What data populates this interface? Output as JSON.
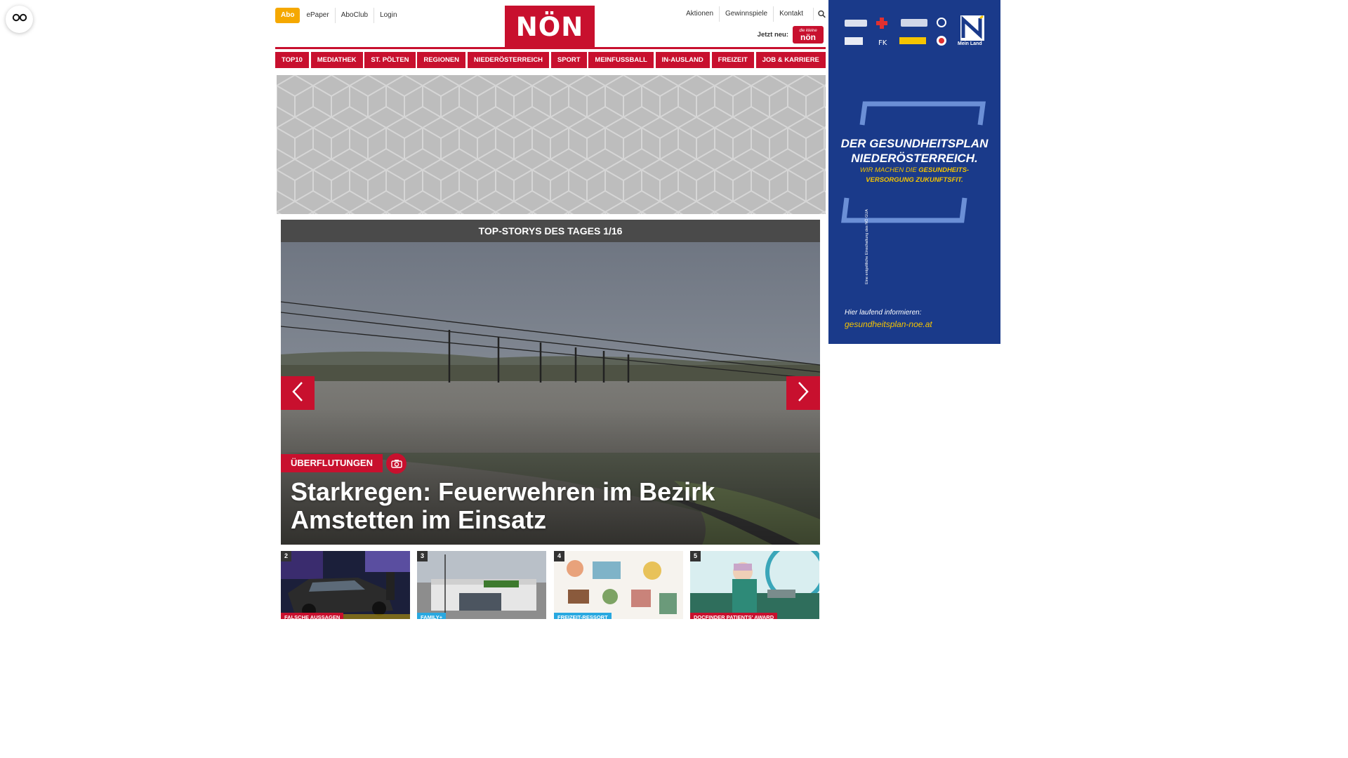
{
  "topnav": {
    "abo": "Abo",
    "links": [
      "ePaper",
      "AboClub",
      "Login"
    ]
  },
  "logo": "NÖN",
  "rightnav": {
    "links": [
      "Aktionen",
      "Gewinnspiele",
      "Kontakt"
    ],
    "jetzt_label": "Jetzt neu:",
    "badge_small": "die kleine",
    "badge_big": "nön"
  },
  "categories": [
    "TOP10",
    "MEDIATHEK",
    "ST. PÖLTEN",
    "REGIONEN",
    "NIEDERÖSTERREICH",
    "SPORT",
    "MEINFUSSBALL",
    "IN-AUSLAND",
    "FREIZEIT",
    "JOB & KARRIERE"
  ],
  "topstories": {
    "header": "TOP-STORYS DES TAGES 1/16",
    "tag": "ÜBERFLUTUNGEN",
    "title": "Starkregen: Feuerwehren im Bezirk Amstetten im Einsatz"
  },
  "thumbs": [
    {
      "num": "2",
      "tag": "FALSCHE AUSSAGEN",
      "tag_color": "#c8102e"
    },
    {
      "num": "3",
      "tag": "FAMILY+",
      "tag_color": "#29a8e0"
    },
    {
      "num": "4",
      "tag": "FREIZEIT-RESSORT",
      "tag_color": "#29a8e0"
    },
    {
      "num": "5",
      "tag": "DOCFINDER PATIENTS' AWARD",
      "tag_color": "#c8102e"
    }
  ],
  "sidead": {
    "title_line1": "DER GESUNDHEITSPLAN",
    "title_line2": "NIEDERÖSTERREICH.",
    "sub_line1_pre": "WIR MACHEN DIE ",
    "sub_line1_bold": "GESUNDHEITS-",
    "sub_line2": "VERSORGUNG ZUKUNFTSFIT.",
    "info": "Hier laufend informieren:",
    "url": "gesundheitsplan-noe.at",
    "logo_label": "Mein Land",
    "vertical_note": "Eine entgeltliche Einschaltung des NÖ GUA"
  },
  "colors": {
    "brand_red": "#c8102e",
    "abo_orange": "#f5a800",
    "ad_blue": "#1a3a8a",
    "ad_yellow": "#f5c400"
  }
}
